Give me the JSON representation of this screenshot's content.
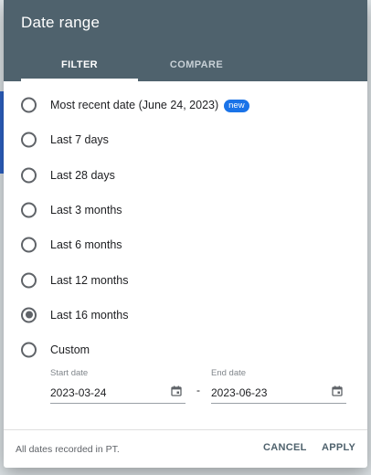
{
  "dialog": {
    "title": "Date range",
    "tabs": [
      {
        "label": "FILTER",
        "active": true
      },
      {
        "label": "COMPARE",
        "active": false
      }
    ],
    "options": [
      {
        "label": "Most recent date (June 24, 2023)",
        "badge": "new",
        "selected": false
      },
      {
        "label": "Last 7 days",
        "selected": false
      },
      {
        "label": "Last 28 days",
        "selected": false
      },
      {
        "label": "Last 3 months",
        "selected": false
      },
      {
        "label": "Last 6 months",
        "selected": false
      },
      {
        "label": "Last 12 months",
        "selected": false
      },
      {
        "label": "Last 16 months",
        "selected": true
      },
      {
        "label": "Custom",
        "selected": false
      }
    ],
    "custom": {
      "start_label": "Start date",
      "start_value": "2023-03-24",
      "end_label": "End date",
      "end_value": "2023-06-23",
      "separator": "-"
    },
    "footer": {
      "note": "All dates recorded in PT.",
      "cancel_label": "CANCEL",
      "apply_label": "APPLY"
    }
  },
  "colors": {
    "header_bg": "#4f626d",
    "badge": "#1a73e8",
    "text": "#202124"
  },
  "icons": {
    "date_picker": "calendar-icon"
  }
}
